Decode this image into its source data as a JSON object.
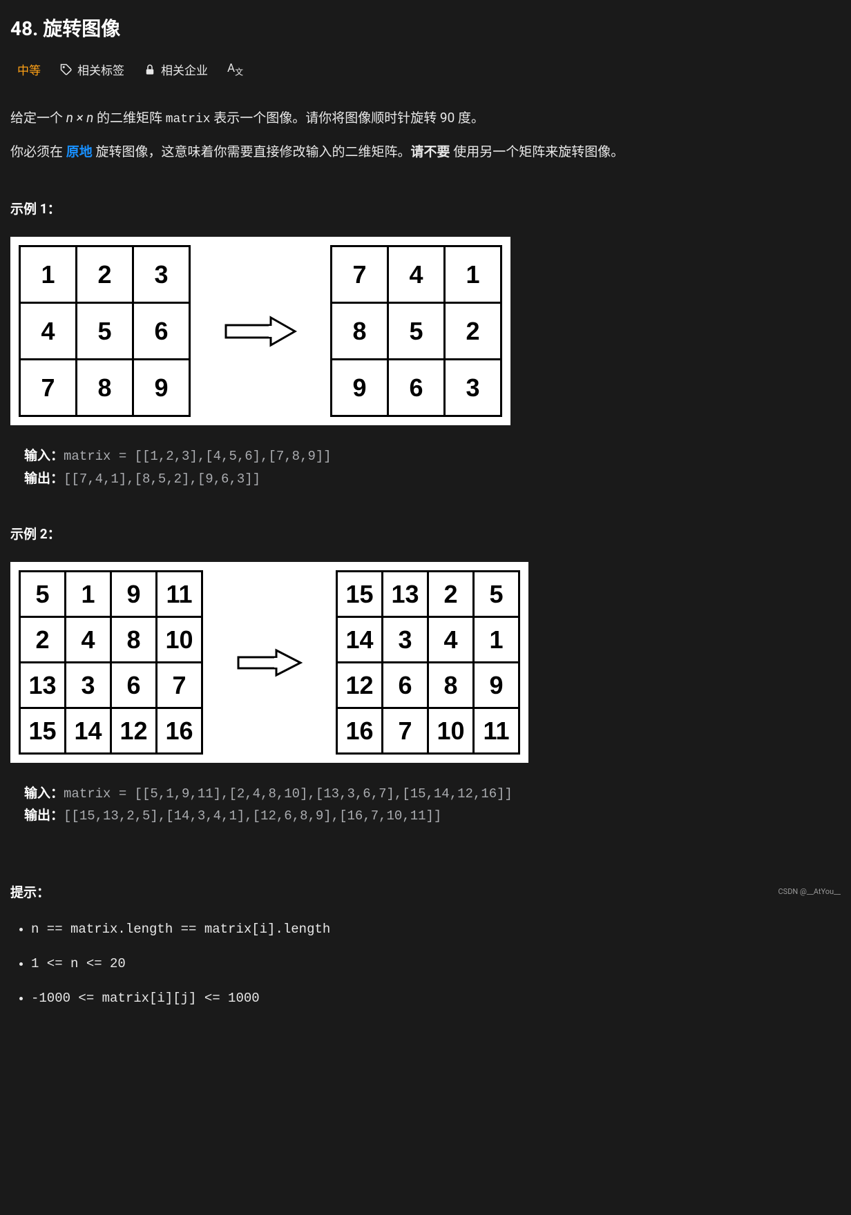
{
  "title": "48. 旋转图像",
  "meta": {
    "difficulty": "中等",
    "tags_label": "相关标签",
    "companies_label": "相关企业",
    "font_icon": "A"
  },
  "desc": {
    "line1_pre": "给定一个 ",
    "nxn": "n × n",
    "line1_mid": " 的二维矩阵 ",
    "matrix_code": "matrix",
    "line1_post": " 表示一个图像。请你将图像顺时针旋转 90 度。",
    "line2_pre": "你必须在 ",
    "inplace": "原地",
    "line2_mid": " 旋转图像，这意味着你需要直接修改输入的二维矩阵。",
    "please_not": "请不要 ",
    "line2_post": "使用另一个矩阵来旋转图像。"
  },
  "example1": {
    "title": "示例 1：",
    "grid_in": [
      [
        "1",
        "2",
        "3"
      ],
      [
        "4",
        "5",
        "6"
      ],
      [
        "7",
        "8",
        "9"
      ]
    ],
    "grid_out": [
      [
        "7",
        "4",
        "1"
      ],
      [
        "8",
        "5",
        "2"
      ],
      [
        "9",
        "6",
        "3"
      ]
    ],
    "input_label": "输入：",
    "input_value": "matrix = [[1,2,3],[4,5,6],[7,8,9]]",
    "output_label": "输出：",
    "output_value": "[[7,4,1],[8,5,2],[9,6,3]]"
  },
  "example2": {
    "title": "示例 2：",
    "grid_in": [
      [
        "5",
        "1",
        "9",
        "11"
      ],
      [
        "2",
        "4",
        "8",
        "10"
      ],
      [
        "13",
        "3",
        "6",
        "7"
      ],
      [
        "15",
        "14",
        "12",
        "16"
      ]
    ],
    "grid_out": [
      [
        "15",
        "13",
        "2",
        "5"
      ],
      [
        "14",
        "3",
        "4",
        "1"
      ],
      [
        "12",
        "6",
        "8",
        "9"
      ],
      [
        "16",
        "7",
        "10",
        "11"
      ]
    ],
    "input_label": "输入：",
    "input_value": "matrix = [[5,1,9,11],[2,4,8,10],[13,3,6,7],[15,14,12,16]]",
    "output_label": "输出：",
    "output_value": "[[15,13,2,5],[14,3,4,1],[12,6,8,9],[16,7,10,11]]"
  },
  "hints": {
    "title": "提示：",
    "items": [
      "n == matrix.length == matrix[i].length",
      "1 <= n <= 20",
      "-1000 <= matrix[i][j] <= 1000"
    ]
  },
  "watermark": "CSDN @__AtYou__"
}
